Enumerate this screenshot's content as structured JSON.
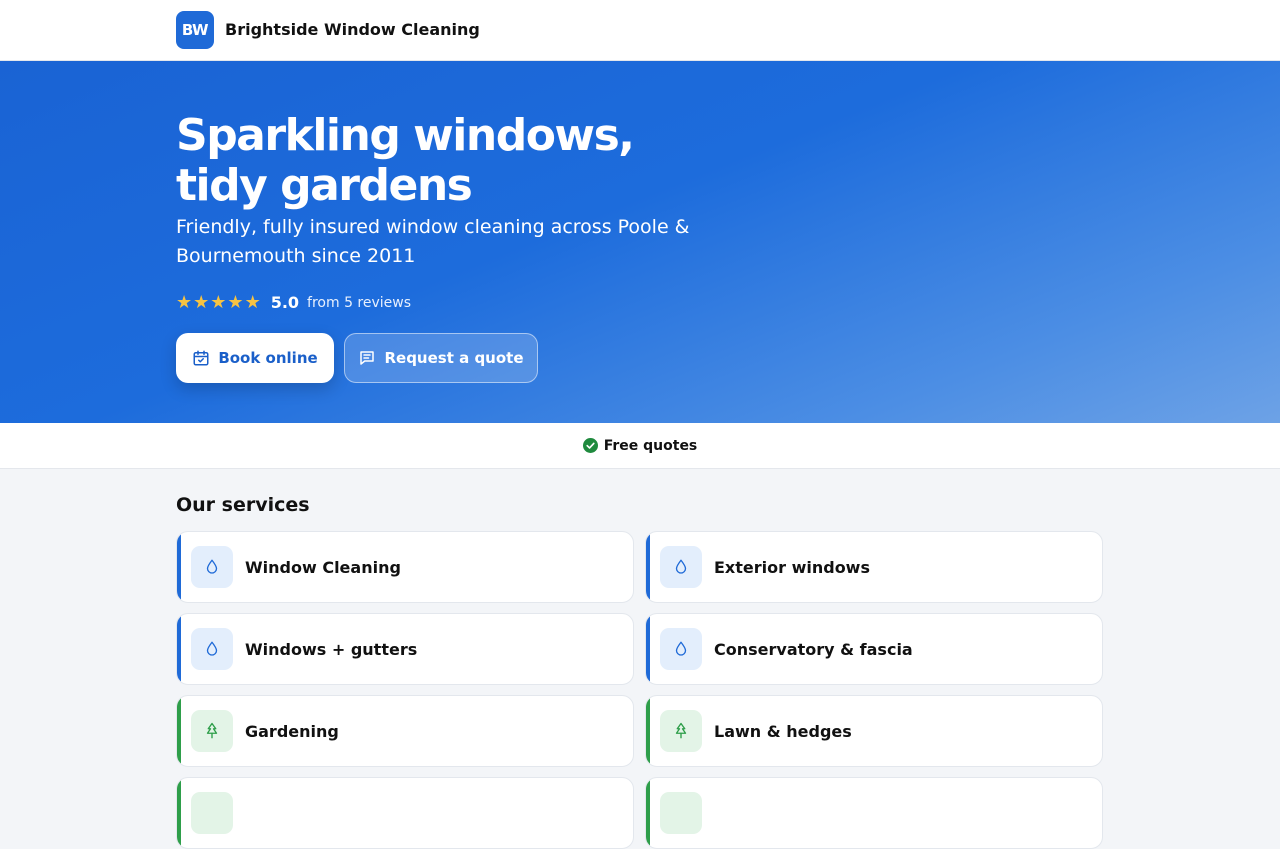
{
  "header": {
    "logo_text": "BW",
    "brand_name": "Brightside Window Cleaning"
  },
  "hero": {
    "title_line1": "Sparkling windows,",
    "title_line2": "tidy gardens",
    "subtitle": "Friendly, fully insured window cleaning across Poole & Bournemouth since 2011",
    "rating": {
      "stars": 5,
      "score": "5.0",
      "reviews": "from 5 reviews"
    },
    "book_label": "Book online",
    "quote_label": "Request a quote"
  },
  "features": {
    "free_quotes": "Free quotes"
  },
  "services": {
    "title": "Our services",
    "items": [
      {
        "label": "Window Cleaning",
        "icon": "droplet-icon",
        "color": "#1f6ad7"
      },
      {
        "label": "Exterior windows",
        "icon": "droplet-icon",
        "color": "#1f6ad7"
      },
      {
        "label": "Windows + gutters",
        "icon": "droplet-icon",
        "color": "#1f6ad7"
      },
      {
        "label": "Conservatory & fascia",
        "icon": "droplet-icon",
        "color": "#1f6ad7"
      },
      {
        "label": "Gardening",
        "icon": "tree-icon",
        "color": "#2e9e4a"
      },
      {
        "label": "Lawn & hedges",
        "icon": "tree-icon",
        "color": "#2e9e4a"
      }
    ]
  },
  "colors": {
    "brand": "#1f6ad7",
    "green": "#2e9e4a",
    "star": "#f6c343"
  }
}
